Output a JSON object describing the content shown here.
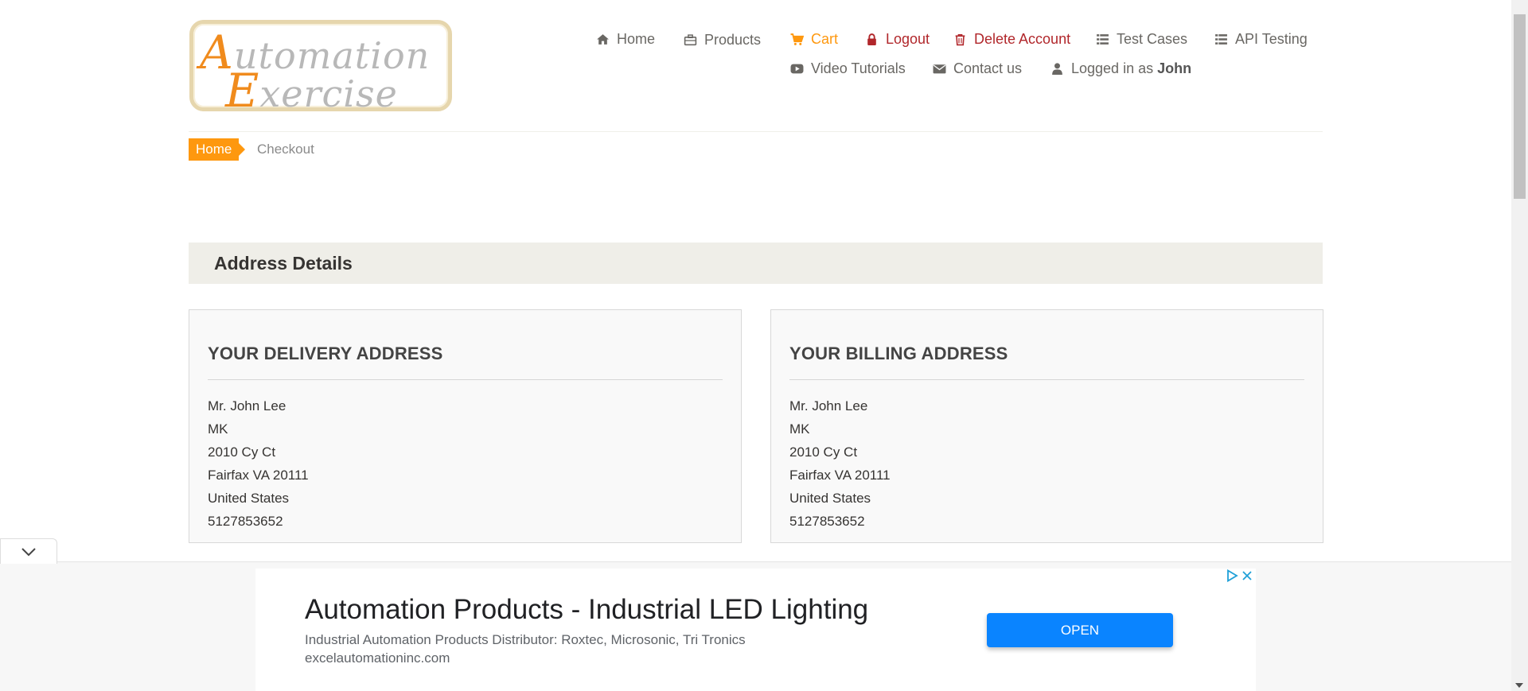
{
  "logo": {
    "line1": "Automation",
    "line2": "Exercise"
  },
  "nav": {
    "home": "Home",
    "products": "Products",
    "cart": "Cart",
    "logout": "Logout",
    "delete_account": "Delete Account",
    "test_cases": "Test Cases",
    "api_testing": "API Testing",
    "video_tutorials": "Video Tutorials",
    "contact_us": "Contact us",
    "logged_in_prefix": "Logged in as",
    "logged_in_user": "John"
  },
  "breadcrumb": {
    "home": "Home",
    "current": "Checkout"
  },
  "address_section": {
    "title": "Address Details"
  },
  "delivery": {
    "heading": "YOUR DELIVERY ADDRESS",
    "lines": [
      "Mr. John Lee",
      "MK",
      "2010 Cy Ct",
      "Fairfax VA 20111",
      "United States",
      "5127853652"
    ]
  },
  "billing": {
    "heading": "YOUR BILLING ADDRESS",
    "lines": [
      "Mr. John Lee",
      "MK",
      "2010 Cy Ct",
      "Fairfax VA 20111",
      "United States",
      "5127853652"
    ]
  },
  "ad": {
    "title": "Automation Products - Industrial LED Lighting",
    "description": "Industrial Automation Products Distributor: Roxtec, Microsonic, Tri Tronics",
    "url": "excelautomationinc.com",
    "button": "OPEN",
    "icons": [
      "ad-choices-icon",
      "close-icon",
      "chevron-down-icon"
    ]
  },
  "colors": {
    "accent": "#fe980f",
    "danger": "#b1272b",
    "text": "#696763",
    "section_bg": "#efeee8",
    "ad_button": "#0a84ff"
  }
}
